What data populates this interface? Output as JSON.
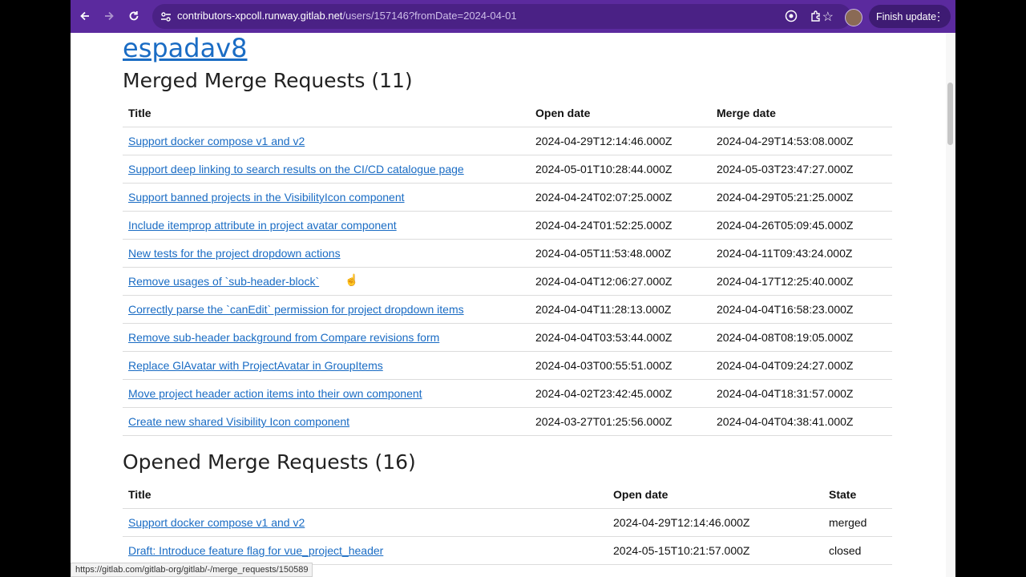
{
  "browser": {
    "url_host": "contributors-xpcoll.runway.gitlab.net",
    "url_path": "/users/157146?fromDate=2024-04-01",
    "finish_update_label": "Finish update",
    "menu_dots": "⋮"
  },
  "page": {
    "username": "espadav8",
    "merged": {
      "heading": "Merged Merge Requests (11)",
      "columns": [
        "Title",
        "Open date",
        "Merge date"
      ],
      "rows": [
        [
          "Support docker compose v1 and v2",
          "2024-04-29T12:14:46.000Z",
          "2024-04-29T14:53:08.000Z"
        ],
        [
          "Support deep linking to search results on the CI/CD catalogue page",
          "2024-05-01T10:28:44.000Z",
          "2024-05-03T23:47:27.000Z"
        ],
        [
          "Support banned projects in the VisibilityIcon component",
          "2024-04-24T02:07:25.000Z",
          "2024-04-29T05:21:25.000Z"
        ],
        [
          "Include itemprop attribute in project avatar component",
          "2024-04-24T01:52:25.000Z",
          "2024-04-26T05:09:45.000Z"
        ],
        [
          "New tests for the project dropdown actions",
          "2024-04-05T11:53:48.000Z",
          "2024-04-11T09:43:24.000Z"
        ],
        [
          "Remove usages of `sub-header-block`",
          "2024-04-04T12:06:27.000Z",
          "2024-04-17T12:25:40.000Z"
        ],
        [
          "Correctly parse the `canEdit` permission for project dropdown items",
          "2024-04-04T11:28:13.000Z",
          "2024-04-04T16:58:23.000Z"
        ],
        [
          "Remove sub-header background from Compare revisions form",
          "2024-04-04T03:53:44.000Z",
          "2024-04-08T08:19:05.000Z"
        ],
        [
          "Replace GlAvatar with ProjectAvatar in GroupItems",
          "2024-04-03T00:55:51.000Z",
          "2024-04-04T09:24:27.000Z"
        ],
        [
          "Move project header action items into their own component",
          "2024-04-02T23:42:45.000Z",
          "2024-04-04T18:31:57.000Z"
        ],
        [
          "Create new shared Visibility Icon component",
          "2024-03-27T01:25:56.000Z",
          "2024-04-04T04:38:41.000Z"
        ]
      ]
    },
    "opened": {
      "heading": "Opened Merge Requests (16)",
      "columns": [
        "Title",
        "Open date",
        "State"
      ],
      "rows": [
        [
          "Support docker compose v1 and v2",
          "2024-04-29T12:14:46.000Z",
          "merged"
        ],
        [
          "Draft: Introduce feature flag for vue_project_header",
          "2024-05-15T10:21:57.000Z",
          "closed"
        ]
      ]
    },
    "status_url": "https://gitlab.com/gitlab-org/gitlab/-/merge_requests/150589"
  }
}
